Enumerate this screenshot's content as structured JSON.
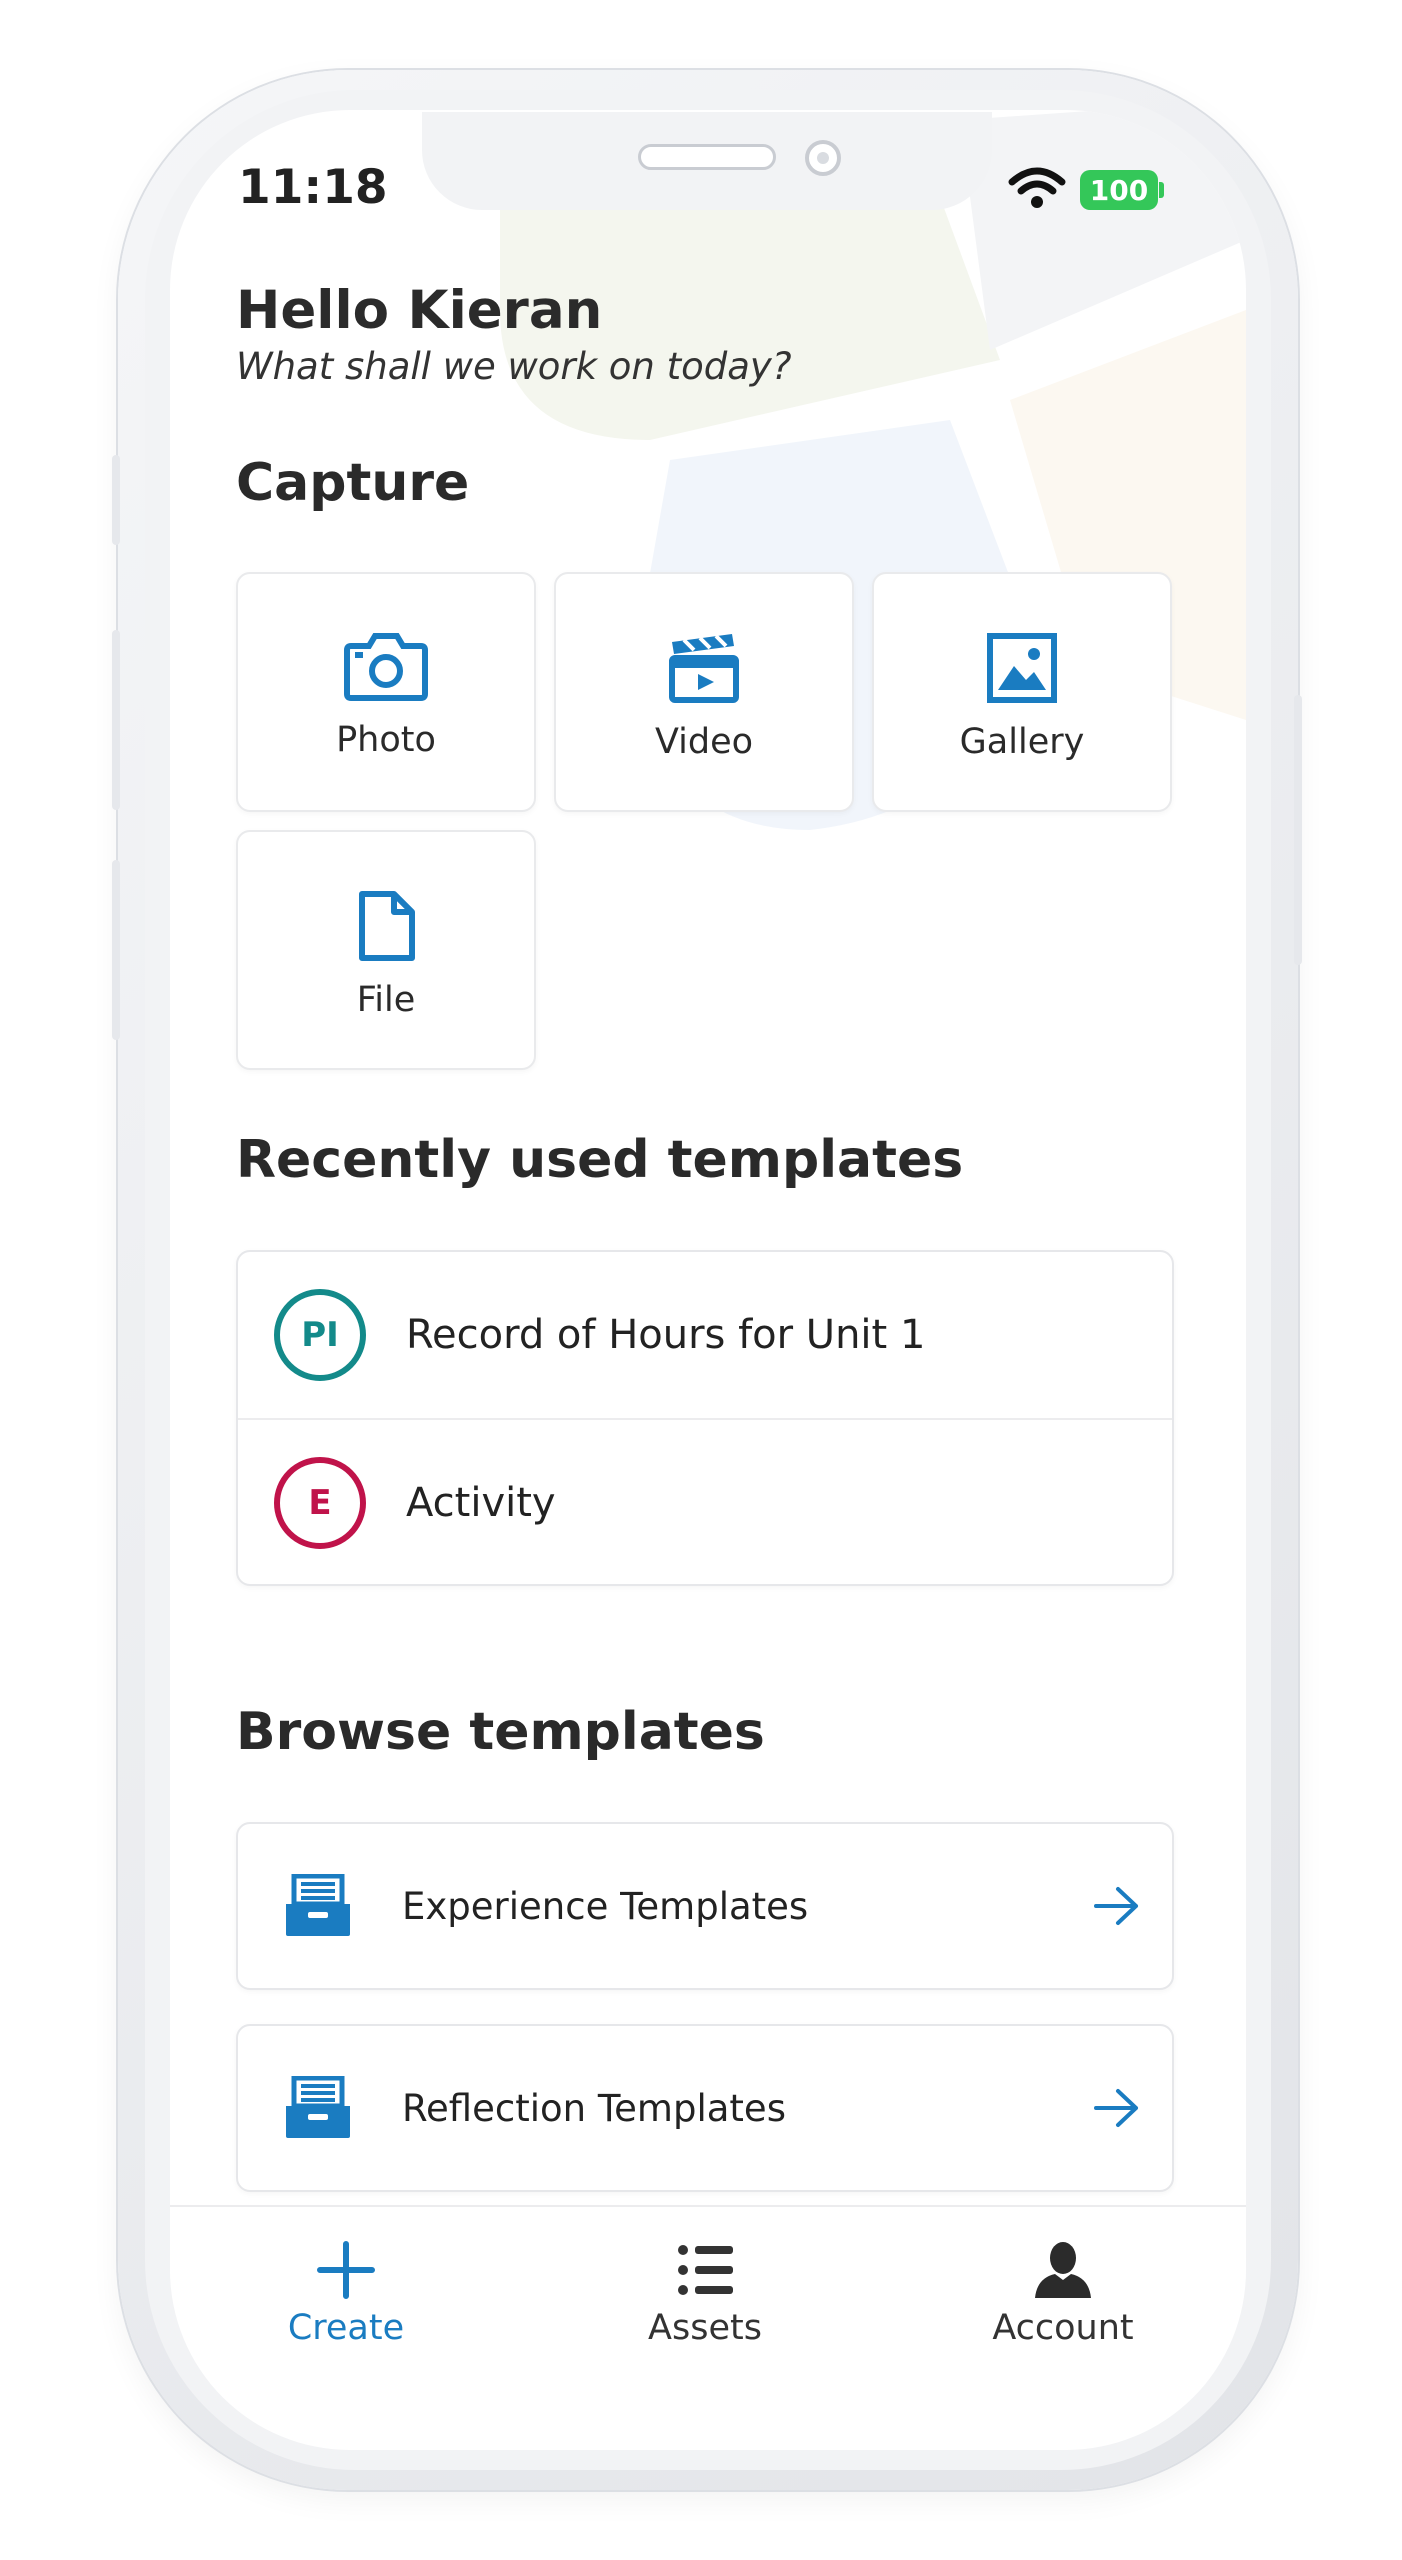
{
  "status_bar": {
    "time": "11:18",
    "battery": "100"
  },
  "greeting": {
    "title": "Hello Kieran",
    "subtitle": "What shall we work on today?"
  },
  "capture": {
    "title": "Capture",
    "items": [
      {
        "label": "Photo",
        "icon": "camera-icon"
      },
      {
        "label": "Video",
        "icon": "clapperboard-icon"
      },
      {
        "label": "Gallery",
        "icon": "image-icon"
      },
      {
        "label": "File",
        "icon": "file-icon"
      }
    ]
  },
  "recent": {
    "title": "Recently used templates",
    "items": [
      {
        "badge": "PI",
        "label": "Record of Hours for Unit 1",
        "color": "#138a8a"
      },
      {
        "badge": "E",
        "label": "Activity",
        "color": "#c0134a"
      }
    ]
  },
  "browse": {
    "title": "Browse templates",
    "items": [
      {
        "label": "Experience Templates",
        "icon": "archive-box-icon"
      },
      {
        "label": "Reflection Templates",
        "icon": "archive-box-icon"
      }
    ]
  },
  "tabs": [
    {
      "label": "Create",
      "icon": "plus-icon",
      "active": true
    },
    {
      "label": "Assets",
      "icon": "list-icon",
      "active": false
    },
    {
      "label": "Account",
      "icon": "user-icon",
      "active": false
    }
  ],
  "colors": {
    "accent": "#1a7cc1",
    "teal": "#138a8a",
    "crimson": "#c0134a"
  }
}
